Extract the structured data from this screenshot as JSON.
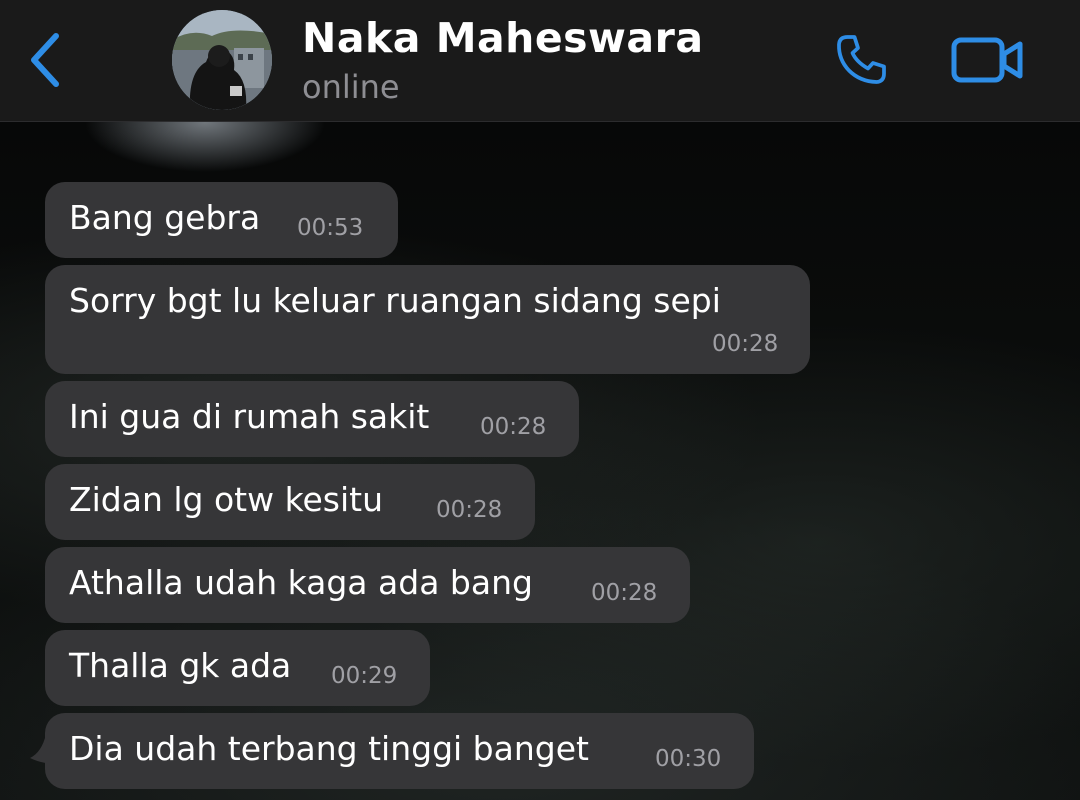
{
  "header": {
    "back_icon": "chevron-left-icon",
    "contact_name": "Naka Maheswara",
    "status": "online",
    "call_icon": "phone-icon",
    "video_icon": "video-camera-icon",
    "accent_color": "#2e8de6"
  },
  "messages": [
    {
      "text": "Bang gebra",
      "time": "00:53"
    },
    {
      "text": "Sorry bgt lu keluar ruangan sidang sepi",
      "time": "00:28"
    },
    {
      "text": "Ini gua di rumah sakit",
      "time": "00:28"
    },
    {
      "text": "Zidan lg otw kesitu",
      "time": "00:28"
    },
    {
      "text": "Athalla udah kaga ada bang",
      "time": "00:28"
    },
    {
      "text": "Thalla gk ada",
      "time": "00:29"
    },
    {
      "text": "Dia udah terbang tinggi banget",
      "time": "00:30"
    }
  ]
}
